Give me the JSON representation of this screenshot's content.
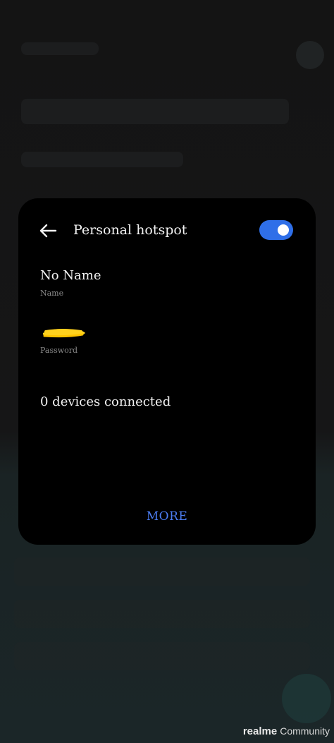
{
  "dialog": {
    "title": "Personal hotspot",
    "hotspot_enabled": true,
    "name_value": "No Name",
    "name_label": "Name",
    "password_label": "Password",
    "devices_text": "0 devices connected",
    "more_label": "MORE"
  },
  "watermark": {
    "brand": "realme",
    "text": "Community"
  },
  "colors": {
    "accent": "#2f6fe8",
    "link": "#4b7cf0",
    "sheet_bg": "#000000",
    "redaction": "#ffd21e"
  },
  "icons": {
    "back": "arrow-left-icon"
  }
}
